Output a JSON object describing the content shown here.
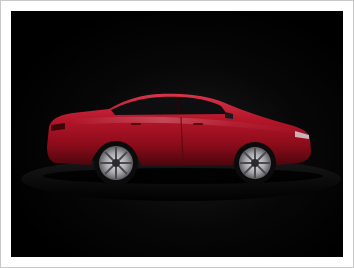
{
  "image": {
    "subject": "car-side-view",
    "colors": {
      "background": "#000000",
      "frame_border": "#c9c9c9",
      "paint_dark": "#5a0710",
      "paint_mid": "#a3101f",
      "paint_light": "#d8354a",
      "glass": "#111114",
      "wheel": "#b9b9bd"
    }
  }
}
